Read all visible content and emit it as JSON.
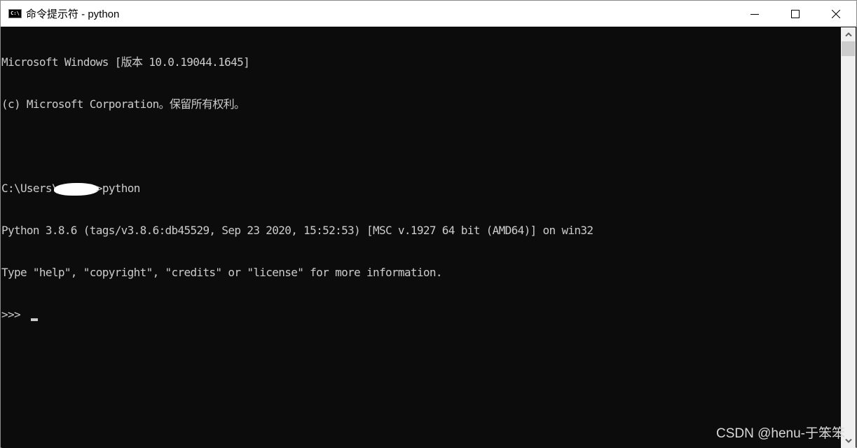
{
  "window": {
    "title": "命令提示符 - python",
    "app_icon_label": "C:\\",
    "controls": [
      "minimize",
      "maximize",
      "close"
    ]
  },
  "console": {
    "lines": [
      "Microsoft Windows [版本 10.0.19044.1645]",
      "(c) Microsoft Corporation。保留所有权利。",
      "",
      "C:\\Users\\",
      "Python 3.8.6 (tags/v3.8.6:db45529, Sep 23 2020, 15:52:53) [MSC v.1927 64 bit (AMD64)] on win32",
      "Type \"help\", \"copyright\", \"credits\" or \"license\" for more information.",
      ">>> "
    ],
    "prompt_path_prefix": "C:\\Users\\",
    "prompt_command": ">python",
    "repl_prompt": ">>> "
  },
  "colors": {
    "console_bg": "#0c0c0c",
    "console_fg": "#cccccc",
    "titlebar_bg": "#ffffff",
    "scrollbar_bg": "#f0f0f0",
    "scrollbar_thumb": "#cdcdcd"
  },
  "watermark": "CSDN @henu-于笨笨"
}
